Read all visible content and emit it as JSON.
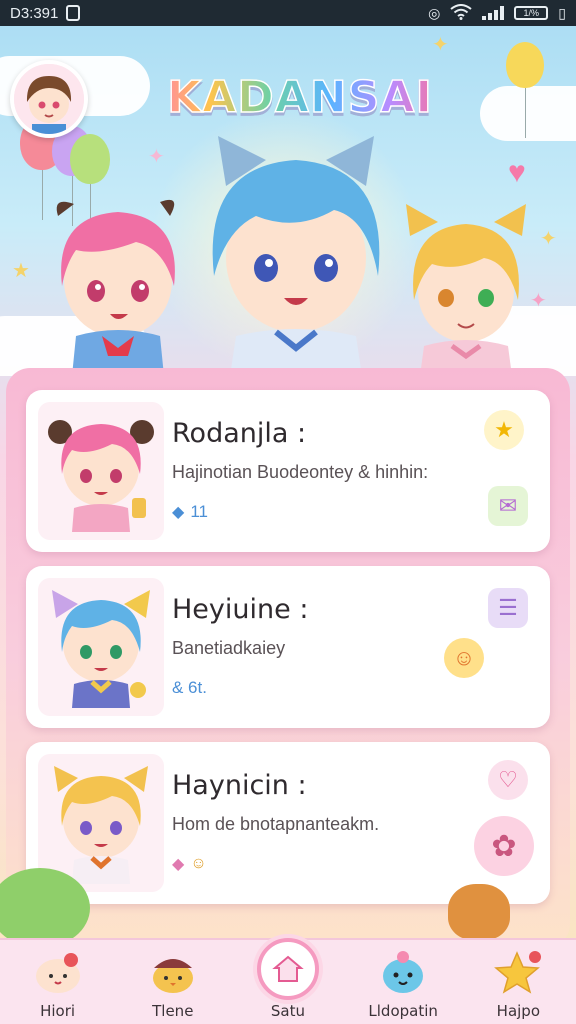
{
  "status_bar": {
    "time": "D3:391",
    "battery_text": "1/%"
  },
  "app": {
    "title": "KADANSAI"
  },
  "cards": [
    {
      "name": "Rodanjla :",
      "description": "Hajinotian Buodeontey & hinhin:",
      "meta": "11",
      "meta_icon": "gem-icon",
      "badges": [
        "star-icon",
        "chat-icon"
      ],
      "accent": "#f48fb6"
    },
    {
      "name": "Heyiuine :",
      "description": "Banetiadkaiey",
      "meta": "& 6t.",
      "meta_icon": "",
      "badges": [
        "note-icon",
        "smile-icon"
      ],
      "accent": "#6cb8e8"
    },
    {
      "name": "Haynicin :",
      "description": "Hom de bnotapnanteakm.",
      "meta": "",
      "meta_icon": "gem-icon",
      "badges": [
        "heart-icon",
        "bear-icon"
      ],
      "accent": "#f2c94c"
    }
  ],
  "bottom_nav": [
    {
      "label": "Hiori",
      "icon": "bun-icon",
      "active": false
    },
    {
      "label": "Tlene",
      "icon": "chick-icon",
      "active": false
    },
    {
      "label": "Satu",
      "icon": "home-icon",
      "active": true
    },
    {
      "label": "Lldopatin",
      "icon": "blob-icon",
      "active": false
    },
    {
      "label": "Hajpo",
      "icon": "star-icon",
      "active": false
    }
  ],
  "colors": {
    "status_bar": "#1f2a33",
    "panel_pink": "#f8b9d4",
    "nav_bg": "#fbe4ef",
    "accent_pink": "#f59ac0"
  }
}
